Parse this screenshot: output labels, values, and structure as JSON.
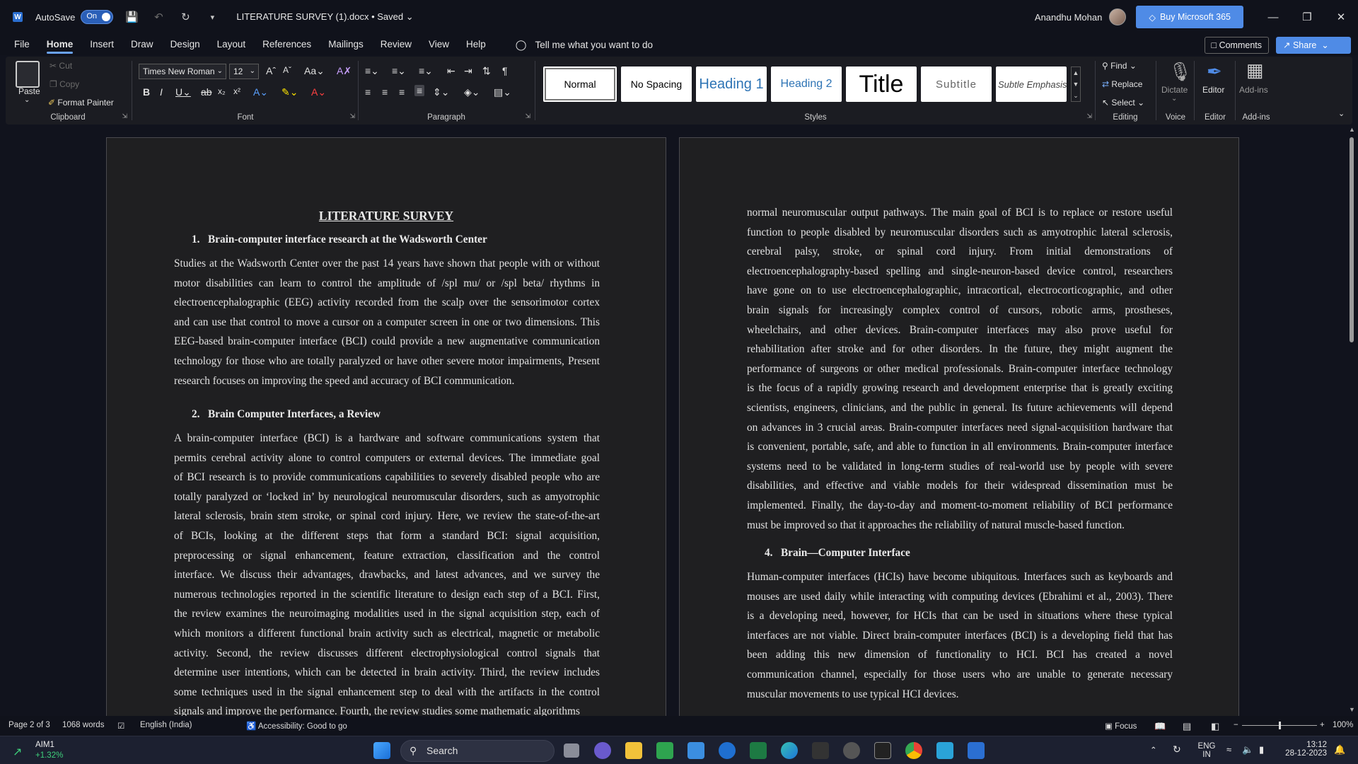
{
  "titlebar": {
    "autosave_label": "AutoSave",
    "autosave_state": "On",
    "document_title": "LITERATURE SURVEY (1).docx • Saved",
    "user_name": "Anandhu Mohan",
    "buy_label": "Buy Microsoft 365"
  },
  "menu": {
    "tabs": [
      "File",
      "Home",
      "Insert",
      "Draw",
      "Design",
      "Layout",
      "References",
      "Mailings",
      "Review",
      "View",
      "Help"
    ],
    "active_tab": "Home",
    "tell_me": "Tell me what you want to do",
    "comments": "Comments",
    "share": "Share"
  },
  "ribbon": {
    "clipboard": {
      "paste": "Paste",
      "cut": "Cut",
      "copy": "Copy",
      "format_painter": "Format Painter",
      "label": "Clipboard"
    },
    "font": {
      "name": "Times New Roman",
      "size": "12",
      "label": "Font"
    },
    "paragraph": {
      "label": "Paragraph"
    },
    "styles": {
      "items": [
        "Normal",
        "No Spacing",
        "Heading 1",
        "Heading 2",
        "Title",
        "Subtitle",
        "Subtle Emphasis"
      ],
      "selected": "Normal",
      "label": "Styles"
    },
    "editing": {
      "find": "Find",
      "replace": "Replace",
      "select": "Select",
      "label": "Editing"
    },
    "voice": {
      "dictate": "Dictate",
      "label": "Voice"
    },
    "editor": {
      "editor": "Editor",
      "label": "Editor"
    },
    "addins": {
      "addins": "Add-ins",
      "label": "Add-ins"
    }
  },
  "document": {
    "page_left": {
      "title": "LITERATURE SURVEY",
      "sec1_heading": "1.   Brain-computer interface research at the Wadsworth Center",
      "sec1_lines": [
        "Studies at the Wadsworth Center over the past 14 years have shown that people with or without",
        "motor disabilities can learn to control the amplitude of /spl mu/ or /spl beta/ rhythms in",
        "electroencephalographic (EEG) activity recorded from the scalp over the sensorimotor cortex",
        "and can use that control to move a cursor on a computer screen in one or two dimensions. This",
        "EEG-based brain-computer interface (BCI) could provide a new augmentative communication",
        "technology for those who are totally paralyzed or have other severe motor impairments, Present",
        "research focuses on improving the speed and accuracy of BCI communication."
      ],
      "sec2_heading": "2.   Brain Computer Interfaces, a Review",
      "sec2_lines": [
        "A brain-computer interface (BCI) is a hardware and software communications system that",
        "permits cerebral activity alone to control computers or external devices. The immediate goal",
        "of BCI research is to provide communications capabilities to severely disabled people who are",
        "totally paralyzed or ‘locked in’ by neurological neuromuscular disorders, such as amyotrophic",
        "lateral sclerosis, brain stem stroke, or spinal cord injury. Here, we review the state-of-the-art",
        "of BCIs, looking at the different steps that form a standard BCI: signal acquisition,",
        "preprocessing or signal enhancement, feature extraction, classification and the control",
        "interface. We discuss their advantages, drawbacks, and latest advances, and we survey the",
        "numerous technologies reported in the scientific literature to design each step of a BCI. First,",
        "the review examines the neuroimaging modalities used in the signal acquisition step, each of",
        "which monitors a different functional brain activity such as electrical, magnetic or metabolic",
        "activity. Second, the review discusses different electrophysiological control signals that",
        "determine user intentions, which can be detected in brain activity. Third, the review includes",
        "some techniques used in the signal enhancement step to deal with the artifacts in the control",
        "signals and improve the performance. Fourth, the review studies some mathematic algorithms"
      ]
    },
    "page_right": {
      "cont_lines": [
        "normal neuromuscular output pathways. The main goal of BCI is to replace or restore useful",
        "function to people disabled by neuromuscular disorders such as amyotrophic lateral sclerosis,",
        "cerebral palsy, stroke, or spinal cord injury. From initial demonstrations of",
        "electroencephalography-based spelling and single-neuron-based device control, researchers",
        "have gone on to use electroencephalographic, intracortical, electrocorticographic, and other",
        "brain signals for increasingly complex control of cursors, robotic arms, prostheses,",
        "wheelchairs, and other devices. Brain-computer interfaces may also prove useful for",
        "rehabilitation after stroke and for other disorders. In the future, they might augment the",
        "performance of surgeons or other medical professionals. Brain-computer interface technology",
        "is the focus of a rapidly growing research and development enterprise that is greatly exciting",
        "scientists, engineers, clinicians, and the public in general. Its future achievements will depend",
        "on advances in 3 crucial areas. Brain-computer interfaces need signal-acquisition hardware that",
        "is convenient, portable, safe, and able to function in all environments. Brain-computer interface",
        "systems need to be validated in long-term studies of real-world use by people with severe",
        "disabilities, and effective and viable models for their widespread dissemination must be",
        "implemented. Finally, the day-to-day and moment-to-moment reliability of BCI performance",
        "must be improved so that it approaches the reliability of natural muscle-based function."
      ],
      "sec4_heading": "4.   Brain—Computer Interface",
      "sec4_lines": [
        "Human-computer interfaces (HCIs) have become ubiquitous. Interfaces such as keyboards and",
        "mouses are used daily while interacting with computing devices (Ebrahimi et al., 2003). There",
        "is a developing need, however, for HCIs that can be used in situations where these typical",
        "interfaces are not viable. Direct brain-computer interfaces (BCI) is a developing field that has",
        "been adding this new dimension of functionality to HCI. BCI has created a novel",
        "communication channel, especially for those users who are unable to generate necessary",
        "muscular movements to use typical HCI devices."
      ]
    }
  },
  "statusbar": {
    "page": "Page 2 of 3",
    "words": "1068 words",
    "language": "English (India)",
    "accessibility": "Accessibility: Good to go",
    "focus": "Focus",
    "zoom": "100%",
    "zoom_fraction": 0.5
  },
  "taskbar": {
    "stock_name": "AIM1",
    "stock_change": "+1.32%",
    "search": "Search",
    "lang_top": "ENG",
    "lang_bottom": "IN",
    "time": "13:12",
    "date": "28-12-2023"
  },
  "colors": {
    "accent": "#4f8be6",
    "page_bg": "#1f1f21",
    "canvas_bg": "#11131d"
  }
}
